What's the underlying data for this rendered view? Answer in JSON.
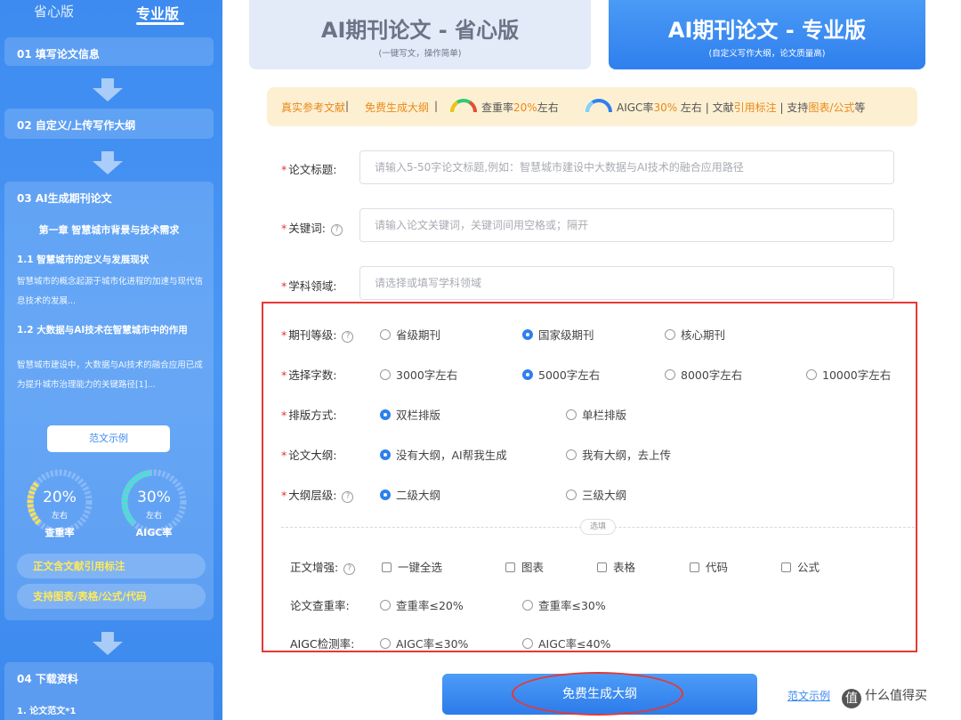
{
  "sidebar": {
    "tabs": [
      "省心版",
      "专业版"
    ],
    "step1": "01 填写论文信息",
    "step2": "02 自定义/上传写作大纲",
    "step3": {
      "title": "03 AI生成期刊论文",
      "chapter": "第一章 智慧城市背景与技术需求",
      "h1": "1.1 智慧城市的定义与发展现状",
      "p1": "智慧城市的概念起源于城市化进程的加速与现代信息技术的发展...",
      "h2": "1.2 大数据与AI技术在智慧城市中的作用",
      "p2": "智慧城市建设中，大数据与AI技术的融合应用已成为提升城市治理能力的关键路径[1]...",
      "example_btn": "范文示例",
      "gauges": [
        {
          "value": "20%",
          "sub": "左右",
          "label": "查重率",
          "color": "#ffe14d",
          "fraction": 0.2
        },
        {
          "value": "30%",
          "sub": "左右",
          "label": "AIGC率",
          "color": "#3ee6c8",
          "fraction": 0.3
        }
      ],
      "pills": [
        "正文含文献引用标注",
        "支持图表/表格/公式/代码"
      ]
    },
    "step4": {
      "title": "04 下载资料",
      "item": "1. 论文范文*1"
    }
  },
  "versions": {
    "v1": {
      "title": "AI期刊论文 - 省心版",
      "sub": "(一键写文，操作简单)"
    },
    "v2": {
      "title": "AI期刊论文 - 专业版",
      "sub": "(自定义写作大纲，论文质量高)"
    }
  },
  "banner": {
    "t1": "真实参考文献",
    "s1": " | ",
    "t2": "免费生成大纲",
    "s2": " | ",
    "t3": "查重率",
    "t3h": "20%",
    "t3e": "左右",
    "t4": "AIGC率",
    "t4h": "30%",
    "t4e": " 左右 | 文献",
    "t4h2": "引用标注",
    "t4e2": " | 支持",
    "t4h3": "图表/公式",
    "t4e3": "等"
  },
  "form": {
    "title": {
      "label": "论文标题:",
      "placeholder": "请输入5-50字论文标题,例如：智慧城市建设中大数据与AI技术的融合应用路径"
    },
    "keywords": {
      "label": "关键词:",
      "placeholder": "请输入论文关键词，关键词间用空格或；隔开"
    },
    "field": {
      "label": "学科领域:",
      "placeholder": "请选择或填写学科领域"
    },
    "level": {
      "label": "期刊等级:",
      "options": [
        "省级期刊",
        "国家级期刊",
        "核心期刊"
      ],
      "selected": 1
    },
    "words": {
      "label": "选择字数:",
      "options": [
        "3000字左右",
        "5000字左右",
        "8000字左右",
        "10000字左右"
      ],
      "selected": 1
    },
    "layout": {
      "label": "排版方式:",
      "options": [
        "双栏排版",
        "单栏排版"
      ],
      "selected": 0
    },
    "outline": {
      "label": "论文大纲:",
      "options": [
        "没有大纲，AI帮我生成",
        "我有大纲，去上传"
      ],
      "selected": 0
    },
    "outline_level": {
      "label": "大纲层级:",
      "options": [
        "二级大纲",
        "三级大纲"
      ],
      "selected": 0
    },
    "divider": "选填",
    "enhance": {
      "label": "正文增强:",
      "options": [
        "一键全选",
        "图表",
        "表格",
        "代码",
        "公式"
      ]
    },
    "dup_rate": {
      "label": "论文查重率:",
      "options": [
        "查重率≤20%",
        "查重率≤30%"
      ]
    },
    "aigc_rate": {
      "label": "AIGC检测率:",
      "options": [
        "AIGC率≤30%",
        "AIGC率≤40%"
      ]
    }
  },
  "actions": {
    "generate": "免费生成大纲",
    "sample": "范文示例"
  },
  "watermark": {
    "badge": "值",
    "text": "什么值得买"
  },
  "colors": {
    "accent": "#2f7fee",
    "highlight": "#e8891b",
    "annotation": "#e53935"
  }
}
